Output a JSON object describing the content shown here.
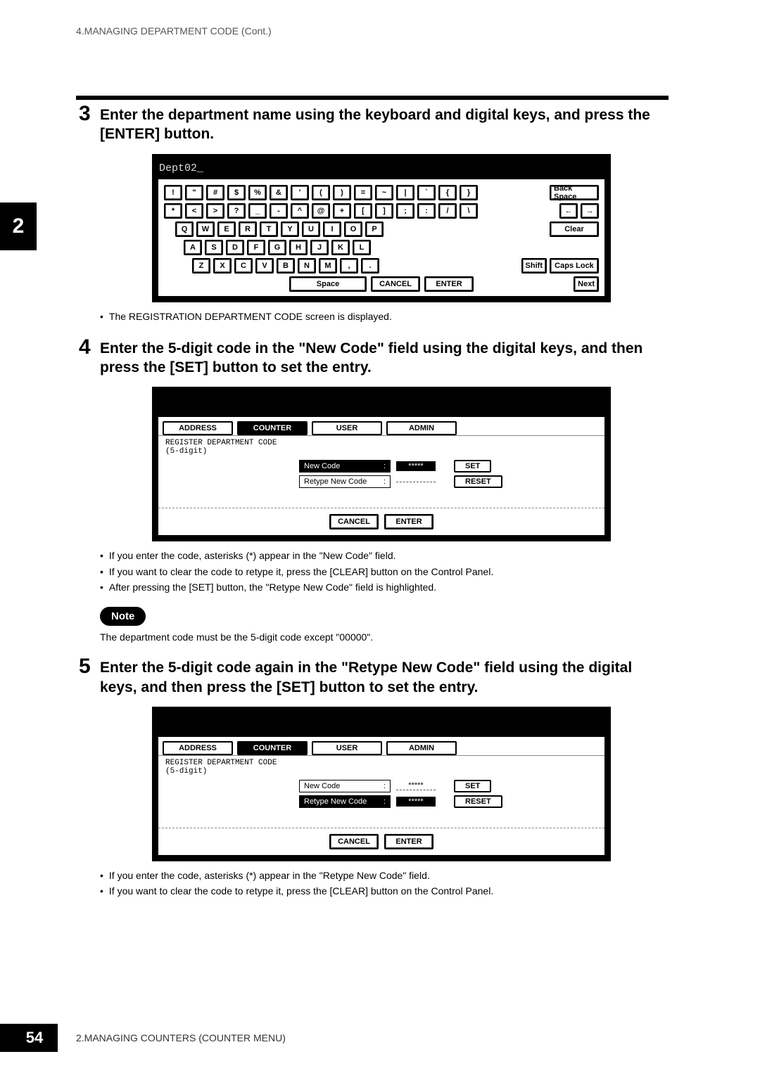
{
  "header": "4.MANAGING DEPARTMENT CODE (Cont.)",
  "side_tab": "2",
  "step3": {
    "num": "3",
    "text": "Enter the department name using the keyboard and digital keys, and press the [ENTER] button.",
    "after": "The REGISTRATION DEPARTMENT CODE screen is displayed."
  },
  "kbd": {
    "input": "Dept02_",
    "rows": {
      "r1": [
        "!",
        "\"",
        "#",
        "$",
        "%",
        "&",
        "'",
        "(",
        ")",
        "=",
        "~",
        "|",
        "`",
        "{",
        "}"
      ],
      "r2": [
        "*",
        "<",
        ">",
        "?",
        "_",
        "-",
        "^",
        "@",
        "+",
        "[",
        "]",
        ";",
        ":",
        "/",
        "\\"
      ],
      "r3": [
        "Q",
        "W",
        "E",
        "R",
        "T",
        "Y",
        "U",
        "I",
        "O",
        "P"
      ],
      "r4": [
        "A",
        "S",
        "D",
        "F",
        "G",
        "H",
        "J",
        "K",
        "L"
      ],
      "r5": [
        "Z",
        "X",
        "C",
        "V",
        "B",
        "N",
        "M",
        ",",
        "."
      ]
    },
    "side": {
      "backspace": "Back Space",
      "left": "←",
      "right": "→",
      "clear": "Clear",
      "shift": "Shift",
      "caps": "Caps Lock",
      "next": "Next"
    },
    "bottom": {
      "space": "Space",
      "cancel": "CANCEL",
      "enter": "ENTER"
    }
  },
  "step4": {
    "num": "4",
    "text": "Enter the 5-digit code in the \"New Code\" field using the digital keys, and then press the [SET] button to set the entry.",
    "bul1": "If you enter the code, asterisks (*) appear in the \"New Code\" field.",
    "bul2": "If you want to clear the code to retype it, press the [CLEAR] button on the Control Panel.",
    "bul3": "After pressing the [SET] button, the \"Retype New Code\" field is highlighted."
  },
  "reg": {
    "tabs": {
      "a": "ADDRESS",
      "b": "COUNTER",
      "c": "USER",
      "d": "ADMIN"
    },
    "title": "REGISTER DEPARTMENT CODE\n(5-digit)",
    "new_label": "New Code",
    "retype_label": "Retype New Code",
    "colon": ":",
    "mask": "*****",
    "set": "SET",
    "reset": "RESET",
    "cancel": "CANCEL",
    "enter": "ENTER"
  },
  "note": {
    "label": "Note",
    "text": "The department code must be the 5-digit code except \"00000\"."
  },
  "step5": {
    "num": "5",
    "text": "Enter the 5-digit code again in the \"Retype New Code\" field using the digital keys, and then press the [SET] button to set the entry.",
    "bul1": "If you enter the code, asterisks (*) appear in the \"Retype New Code\" field.",
    "bul2": "If you want to clear the code to retype it, press the [CLEAR] button on the Control Panel."
  },
  "footer": {
    "page": "54",
    "chapter": "2.MANAGING COUNTERS (COUNTER MENU)"
  }
}
